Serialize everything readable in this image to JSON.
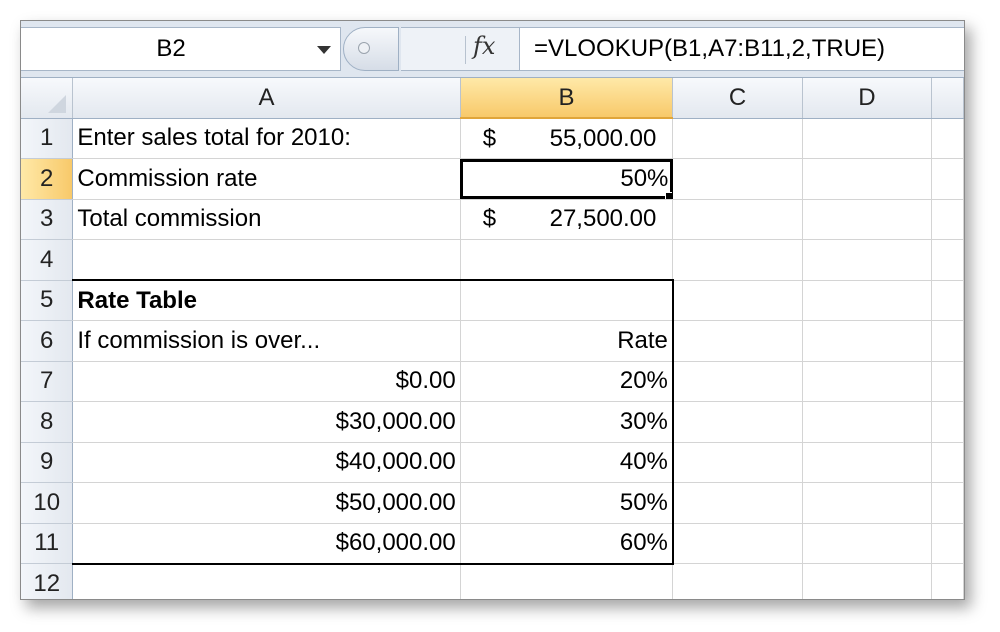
{
  "name_box": {
    "value": "B2"
  },
  "formula_bar": {
    "fx_label": "fx",
    "formula": "=VLOOKUP(B1,A7:B11,2,TRUE)"
  },
  "columns": [
    "A",
    "B",
    "C",
    "D"
  ],
  "rows": [
    {
      "num": "1",
      "a": "Enter sales total for 2010:",
      "b_sym": "$",
      "b": "55,000.00"
    },
    {
      "num": "2",
      "a": "Commission rate",
      "b": "50%"
    },
    {
      "num": "3",
      "a": "Total commission",
      "b_sym": "$",
      "b": "27,500.00"
    },
    {
      "num": "4",
      "a": "",
      "b": ""
    },
    {
      "num": "5",
      "a": "Rate Table",
      "b": ""
    },
    {
      "num": "6",
      "a": "If commission is over...",
      "b": "Rate"
    },
    {
      "num": "7",
      "a": "$0.00",
      "b": "20%"
    },
    {
      "num": "8",
      "a": "$30,000.00",
      "b": "30%"
    },
    {
      "num": "9",
      "a": "$40,000.00",
      "b": "40%"
    },
    {
      "num": "10",
      "a": "$50,000.00",
      "b": "50%"
    },
    {
      "num": "11",
      "a": "$60,000.00",
      "b": "60%"
    },
    {
      "num": "12",
      "a": "",
      "b": ""
    }
  ],
  "selection": {
    "cell": "B2",
    "column": "B",
    "row": "2"
  },
  "colors": {
    "header_active": "#f8c96a",
    "header_bg": "#e3e8ef",
    "formula_bar_bg": "#dfe6ef"
  }
}
